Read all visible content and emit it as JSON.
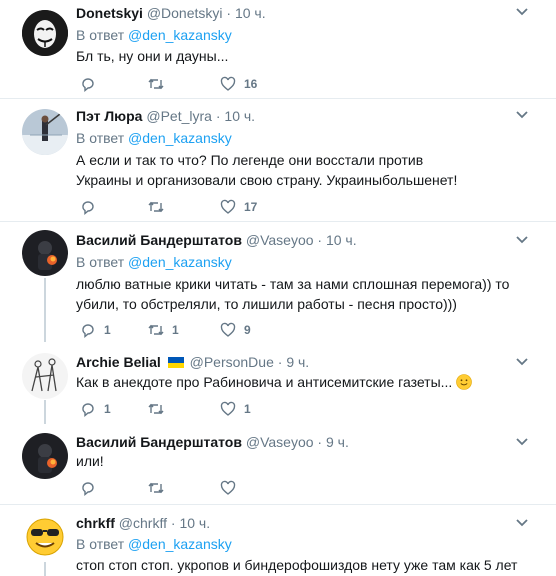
{
  "tweets": [
    {
      "name": "Donetskyi",
      "handle": "@Donetskyi",
      "dot": "·",
      "time": "10 ч.",
      "replying_prefix": "В ответ ",
      "replying_to": "@den_kazansky",
      "text": "Бл  ть, ну они и дауны...",
      "replies": "",
      "retweets": "",
      "likes": "16"
    },
    {
      "name": "Пэт Люра",
      "handle": "@Pet_lyra",
      "dot": "·",
      "time": "10 ч.",
      "replying_prefix": "В ответ ",
      "replying_to": "@den_kazansky",
      "text": "А если и так то что? По легенде они восстали против Украины и организовали  свою страну. Украиныбольшенет!",
      "replies": "",
      "retweets": "",
      "likes": "17"
    },
    {
      "name": "Василий Бандерштатов",
      "handle": "@Vaseyoo",
      "dot": "·",
      "time": "10 ч.",
      "replying_prefix": "В ответ ",
      "replying_to": "@den_kazansky",
      "text": "люблю ватные крики читать - там за нами сплошная перемога)) то убили, то обстреляли, то лишили работы - песня просто)))",
      "replies": "1",
      "retweets": "1",
      "likes": "9"
    },
    {
      "name": "Archie Belial",
      "handle": "@PersonDue",
      "dot": "·",
      "time": "9 ч.",
      "text": "Как в анекдоте про Рабиновича и антисемитские газеты...",
      "replies": "1",
      "retweets": "",
      "likes": "1"
    },
    {
      "name": "Василий Бандерштатов",
      "handle": "@Vaseyoo",
      "dot": "·",
      "time": "9 ч.",
      "text": "или!",
      "replies": "",
      "retweets": "",
      "likes": ""
    },
    {
      "name": "chrkff",
      "handle": "@chrkff",
      "dot": "·",
      "time": "10 ч.",
      "replying_prefix": "В ответ ",
      "replying_to": "@den_kazansky",
      "text": "стоп стоп стоп. укропов и биндерофошиздов нету уже там как 5 лет"
    }
  ],
  "colors": {
    "accent": "#1da1f2",
    "secondary_text": "#657786",
    "divider": "#e6ecf0",
    "thread_line": "#ccd6dd"
  }
}
